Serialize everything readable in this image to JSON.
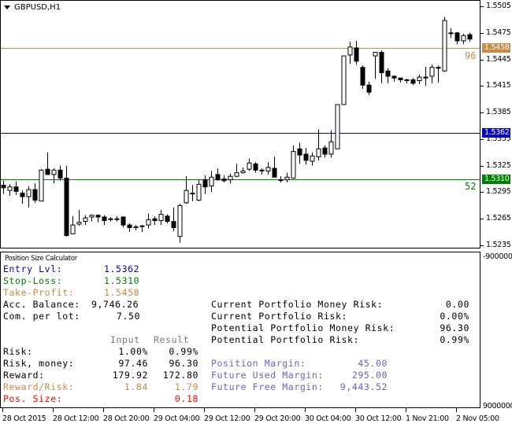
{
  "chart": {
    "symbol": "GBPUSD,H1",
    "price_axis": {
      "ticks": [
        "1.5505",
        "1.5475",
        "1.5445",
        "1.5415",
        "1.5385",
        "1.5355",
        "1.5325",
        "1.5295",
        "1.5265",
        "1.5235"
      ],
      "range": [
        1.5235,
        1.5505
      ]
    },
    "lines": {
      "entry": {
        "label": "1.5362",
        "value": 1.5362,
        "color": "#0000cc"
      },
      "stop_loss": {
        "label": "1.5310",
        "value": 1.531,
        "color": "#008000",
        "pips_label": "52"
      },
      "take_profit": {
        "label": "1.5458",
        "value": 1.5458,
        "color": "#c88a45",
        "pips_label": "96"
      }
    },
    "time_axis": [
      "28 Oct 2015",
      "28 Oct 12:00",
      "28 Oct 20:00",
      "29 Oct 04:00",
      "29 Oct 12:00",
      "29 Oct 20:00",
      "30 Oct 04:00",
      "30 Oct 12:00",
      "1 Nov 21:00",
      "2 Nov 05:00"
    ],
    "indicator_axis": {
      "top": "-9000000",
      "bottom": "9000000"
    }
  },
  "chart_data": {
    "type": "candlestick",
    "title": "GBPUSD,H1",
    "ylim": [
      1.5235,
      1.5505
    ],
    "candles": [
      [
        1.5303,
        1.5308,
        1.5293,
        1.53
      ],
      [
        1.5297,
        1.5304,
        1.5291,
        1.5301
      ],
      [
        1.5301,
        1.5307,
        1.5292,
        1.5296
      ],
      [
        1.5294,
        1.5297,
        1.5282,
        1.529
      ],
      [
        1.529,
        1.5302,
        1.5278,
        1.5298
      ],
      [
        1.5298,
        1.5305,
        1.5283,
        1.5286
      ],
      [
        1.5285,
        1.5321,
        1.5285,
        1.532
      ],
      [
        1.5321,
        1.534,
        1.5321,
        1.5315
      ],
      [
        1.5315,
        1.5322,
        1.5305,
        1.532
      ],
      [
        1.532,
        1.5325,
        1.5308,
        1.5311
      ],
      [
        1.5311,
        1.5325,
        1.5245,
        1.5246
      ],
      [
        1.5248,
        1.5268,
        1.5248,
        1.5258
      ],
      [
        1.5259,
        1.5275,
        1.5257,
        1.5261
      ],
      [
        1.5262,
        1.5269,
        1.5258,
        1.5266
      ],
      [
        1.5267,
        1.527,
        1.5262,
        1.5269
      ],
      [
        1.5269,
        1.527,
        1.5261,
        1.5267
      ],
      [
        1.5267,
        1.5269,
        1.5258,
        1.5263
      ],
      [
        1.5265,
        1.5267,
        1.5262,
        1.5265
      ],
      [
        1.5265,
        1.5268,
        1.5262,
        1.5265
      ],
      [
        1.5267,
        1.5268,
        1.5255,
        1.5258
      ],
      [
        1.5258,
        1.526,
        1.525,
        1.5255
      ],
      [
        1.5256,
        1.5258,
        1.5252,
        1.5256
      ],
      [
        1.5257,
        1.5258,
        1.525,
        1.5257
      ],
      [
        1.5258,
        1.5271,
        1.5254,
        1.5264
      ],
      [
        1.5265,
        1.5268,
        1.5258,
        1.5263
      ],
      [
        1.5263,
        1.5275,
        1.5258,
        1.527
      ],
      [
        1.5268,
        1.527,
        1.526,
        1.5262
      ],
      [
        1.5262,
        1.5278,
        1.5251,
        1.5255
      ],
      [
        1.5245,
        1.5282,
        1.5238,
        1.528
      ],
      [
        1.5283,
        1.5313,
        1.5282,
        1.5297
      ],
      [
        1.5294,
        1.5303,
        1.5285,
        1.5293
      ],
      [
        1.5286,
        1.5309,
        1.5285,
        1.5304
      ],
      [
        1.5309,
        1.5314,
        1.5293,
        1.5301
      ],
      [
        1.5302,
        1.5319,
        1.5295,
        1.5312
      ],
      [
        1.5315,
        1.5322,
        1.5308,
        1.5309
      ],
      [
        1.531,
        1.5314,
        1.5306,
        1.5308
      ],
      [
        1.5309,
        1.5316,
        1.5305,
        1.5313
      ],
      [
        1.5313,
        1.5327,
        1.5312,
        1.5317
      ],
      [
        1.5317,
        1.5323,
        1.5316,
        1.5319
      ],
      [
        1.5321,
        1.5333,
        1.5319,
        1.5328
      ],
      [
        1.5327,
        1.5329,
        1.5317,
        1.532
      ],
      [
        1.532,
        1.5322,
        1.5315,
        1.5319
      ],
      [
        1.5319,
        1.5329,
        1.5315,
        1.5323
      ],
      [
        1.5322,
        1.5335,
        1.5312,
        1.5312
      ],
      [
        1.5309,
        1.5313,
        1.5306,
        1.5309
      ],
      [
        1.5309,
        1.5317,
        1.5306,
        1.5312
      ],
      [
        1.5311,
        1.5348,
        1.531,
        1.5341
      ],
      [
        1.5344,
        1.5351,
        1.5327,
        1.5337
      ],
      [
        1.5338,
        1.5345,
        1.5326,
        1.5331
      ],
      [
        1.533,
        1.534,
        1.5325,
        1.5336
      ],
      [
        1.5335,
        1.5366,
        1.5331,
        1.5344
      ],
      [
        1.5345,
        1.5348,
        1.5334,
        1.5338
      ],
      [
        1.5338,
        1.5365,
        1.5334,
        1.5352
      ],
      [
        1.5344,
        1.5388,
        1.5344,
        1.5394
      ],
      [
        1.5394,
        1.5434,
        1.5395,
        1.5449
      ],
      [
        1.545,
        1.5465,
        1.544,
        1.5459
      ],
      [
        1.5458,
        1.5466,
        1.5439,
        1.5443
      ],
      [
        1.5436,
        1.5438,
        1.5412,
        1.5416
      ],
      [
        1.5416,
        1.542,
        1.5405,
        1.5408
      ],
      [
        1.5449,
        1.5453,
        1.5423,
        1.5453
      ],
      [
        1.5453,
        1.5455,
        1.5418,
        1.543
      ],
      [
        1.5432,
        1.5435,
        1.5418,
        1.5426
      ],
      [
        1.5426,
        1.5427,
        1.542,
        1.5424
      ],
      [
        1.5424,
        1.5424,
        1.5419,
        1.5422
      ],
      [
        1.5422,
        1.5423,
        1.5418,
        1.5422
      ],
      [
        1.5422,
        1.5424,
        1.5416,
        1.5418
      ],
      [
        1.5421,
        1.5428,
        1.5417,
        1.5425
      ],
      [
        1.5425,
        1.5437,
        1.5415,
        1.5424
      ],
      [
        1.5426,
        1.5439,
        1.5418,
        1.5436
      ],
      [
        1.5436,
        1.5438,
        1.5419,
        1.5435
      ],
      [
        1.5432,
        1.5493,
        1.5431,
        1.5489
      ],
      [
        1.5475,
        1.548,
        1.5469,
        1.5475
      ],
      [
        1.5475,
        1.5476,
        1.5462,
        1.5466
      ],
      [
        1.5466,
        1.5474,
        1.5462,
        1.5472
      ],
      [
        1.5473,
        1.5475,
        1.5465,
        1.5468
      ]
    ]
  },
  "calculator": {
    "title": "Position Size Calculator",
    "entry": {
      "label": "Entry Lvl:",
      "value": "1.5362"
    },
    "stop_loss": {
      "label": "Stop-Loss:",
      "value": "1.5310"
    },
    "take_profit": {
      "label": "Take-Profit:",
      "value": "1.5458"
    },
    "balance": {
      "label": "Acc. Balance:",
      "value": "9,746.26"
    },
    "commission": {
      "label": "Com. per lot:",
      "value": "7.50"
    },
    "headers": {
      "input": "Input",
      "result": "Result"
    },
    "rows": [
      {
        "label": "Risk:",
        "input": "1.00%",
        "result": "0.99%"
      },
      {
        "label": "Risk, money:",
        "input": "97.46",
        "result": "96.30"
      },
      {
        "label": "Reward:",
        "input": "179.92",
        "result": "172.80"
      },
      {
        "label": "Reward/Risk:",
        "input": "1.84",
        "result": "1.79"
      },
      {
        "label": "Pos. Size:",
        "input": "",
        "result": "0.18"
      }
    ],
    "portfolio": [
      {
        "label": "Current Portfolio Money Risk:",
        "value": "0.00"
      },
      {
        "label": "Current Portfolio Risk:",
        "value": "0.00%"
      },
      {
        "label": "Potential Portfolio Money Risk:",
        "value": "96.30"
      },
      {
        "label": "Potential Portfolio Risk:",
        "value": "0.99%"
      }
    ],
    "margin": [
      {
        "label": "Position Margin:",
        "value": "45.00"
      },
      {
        "label": "Future Used Margin:",
        "value": "295.00"
      },
      {
        "label": "Future Free Margin:",
        "value": "9,443.52"
      }
    ]
  }
}
